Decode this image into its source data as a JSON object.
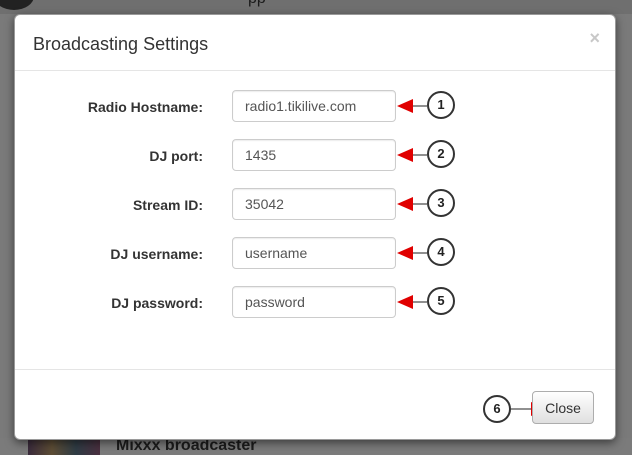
{
  "background": {
    "top_text": "pp",
    "bottom_text": "Mixxx broadcaster"
  },
  "modal": {
    "title": "Broadcasting Settings",
    "close_symbol": "×",
    "fields": [
      {
        "label": "Radio Hostname:",
        "value": "radio1.tikilive.com",
        "callout": "1"
      },
      {
        "label": "DJ port:",
        "value": "1435",
        "callout": "2"
      },
      {
        "label": "Stream ID:",
        "value": "35042",
        "callout": "3"
      },
      {
        "label": "DJ username:",
        "value": "username",
        "callout": "4"
      },
      {
        "label": "DJ password:",
        "value": "password",
        "callout": "5"
      }
    ],
    "footer": {
      "close_label": "Close",
      "callout": "6"
    }
  },
  "colors": {
    "arrow": "#e00000",
    "overlay": "#7a7a7a"
  }
}
